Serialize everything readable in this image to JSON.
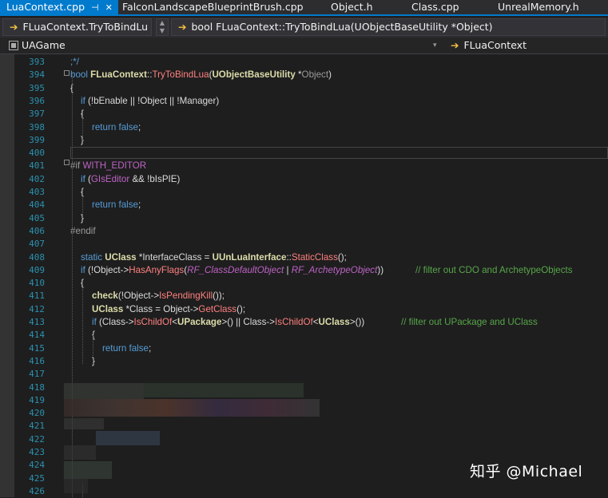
{
  "tabs": [
    {
      "label": "LuaContext.cpp",
      "active": true,
      "pin_glyph": "⊣",
      "close_glyph": "✕"
    },
    {
      "label": "FalconLandscapeBlueprintBrush.cpp"
    },
    {
      "label": "Object.h"
    },
    {
      "label": "Class.cpp"
    },
    {
      "label": "UnrealMemory.h"
    }
  ],
  "navbar": {
    "left_combo": "FLuaContext.TryToBindLu",
    "right_combo": "bool FLuaContext::TryToBindLua(UObjectBaseUtility *Object)",
    "arrow": "➔",
    "spinner_up": "▲",
    "spinner_down": "▼"
  },
  "scopebar": {
    "project": "UAGame",
    "scope": "FLuaContext",
    "dropdown_glyph": "▾"
  },
  "lines": [
    "393",
    "394",
    "395",
    "396",
    "397",
    "398",
    "399",
    "400",
    "401",
    "402",
    "403",
    "404",
    "405",
    "406",
    "407",
    "408",
    "409",
    "410",
    "411",
    "412",
    "413",
    "414",
    "415",
    "416",
    "417",
    "418",
    "419",
    "420",
    "421",
    "422",
    "423",
    "424",
    "425",
    "426"
  ],
  "code": {
    "l393": ";*/",
    "l394": [
      "bool ",
      "FLuaContext",
      "::",
      "TryToBindLua",
      "(",
      "UObjectBaseUtility",
      " *",
      "Object",
      ")"
    ],
    "l395": "{",
    "l396": [
      "if",
      " (!",
      "bEnable",
      " || !",
      "Object",
      " || !",
      "Manager",
      ")"
    ],
    "l397": "{",
    "l398": [
      "return ",
      "false",
      ";"
    ],
    "l399": "}",
    "l401": [
      "#if ",
      "WITH_EDITOR"
    ],
    "l402": [
      "if",
      " (",
      "GIsEditor",
      " && !",
      "bIsPIE",
      ")"
    ],
    "l403": "{",
    "l404": [
      "return ",
      "false",
      ";"
    ],
    "l405": "}",
    "l406": "#endif",
    "l408": [
      "static ",
      "UClass",
      " *",
      "InterfaceClass",
      " = ",
      "UUnLuaInterface",
      "::",
      "StaticClass",
      "();"
    ],
    "l409": [
      "if",
      " (!",
      "Object",
      "->",
      "HasAnyFlags",
      "(",
      "RF_ClassDefaultObject",
      " | ",
      "RF_ArchetypeObject",
      "))",
      "// filter out CDO and ArchetypeObjects"
    ],
    "l410": "{",
    "l411": [
      "check",
      "(!",
      "Object",
      "->",
      "IsPendingKill",
      "());"
    ],
    "l412": [
      "UClass",
      " *",
      "Class",
      " = ",
      "Object",
      "->",
      "GetClass",
      "();"
    ],
    "l413": [
      "if",
      " (",
      "Class",
      "->",
      "IsChildOf",
      "<",
      "UPackage",
      ">() || ",
      "Class",
      "->",
      "IsChildOf",
      "<",
      "UClass",
      ">())",
      "// filter out UPackage and UClass"
    ],
    "l414": "{",
    "l415": [
      "return ",
      "false",
      ";"
    ],
    "l416": "}"
  },
  "watermark": "知乎 @Michael",
  "colors": {
    "accent": "#007acc",
    "keyword": "#569cd6",
    "class_type": "#dcdcaa",
    "function": "#ff8080",
    "macro": "#bd63c5",
    "comment": "#57a64a",
    "line_number": "#2b91af"
  }
}
